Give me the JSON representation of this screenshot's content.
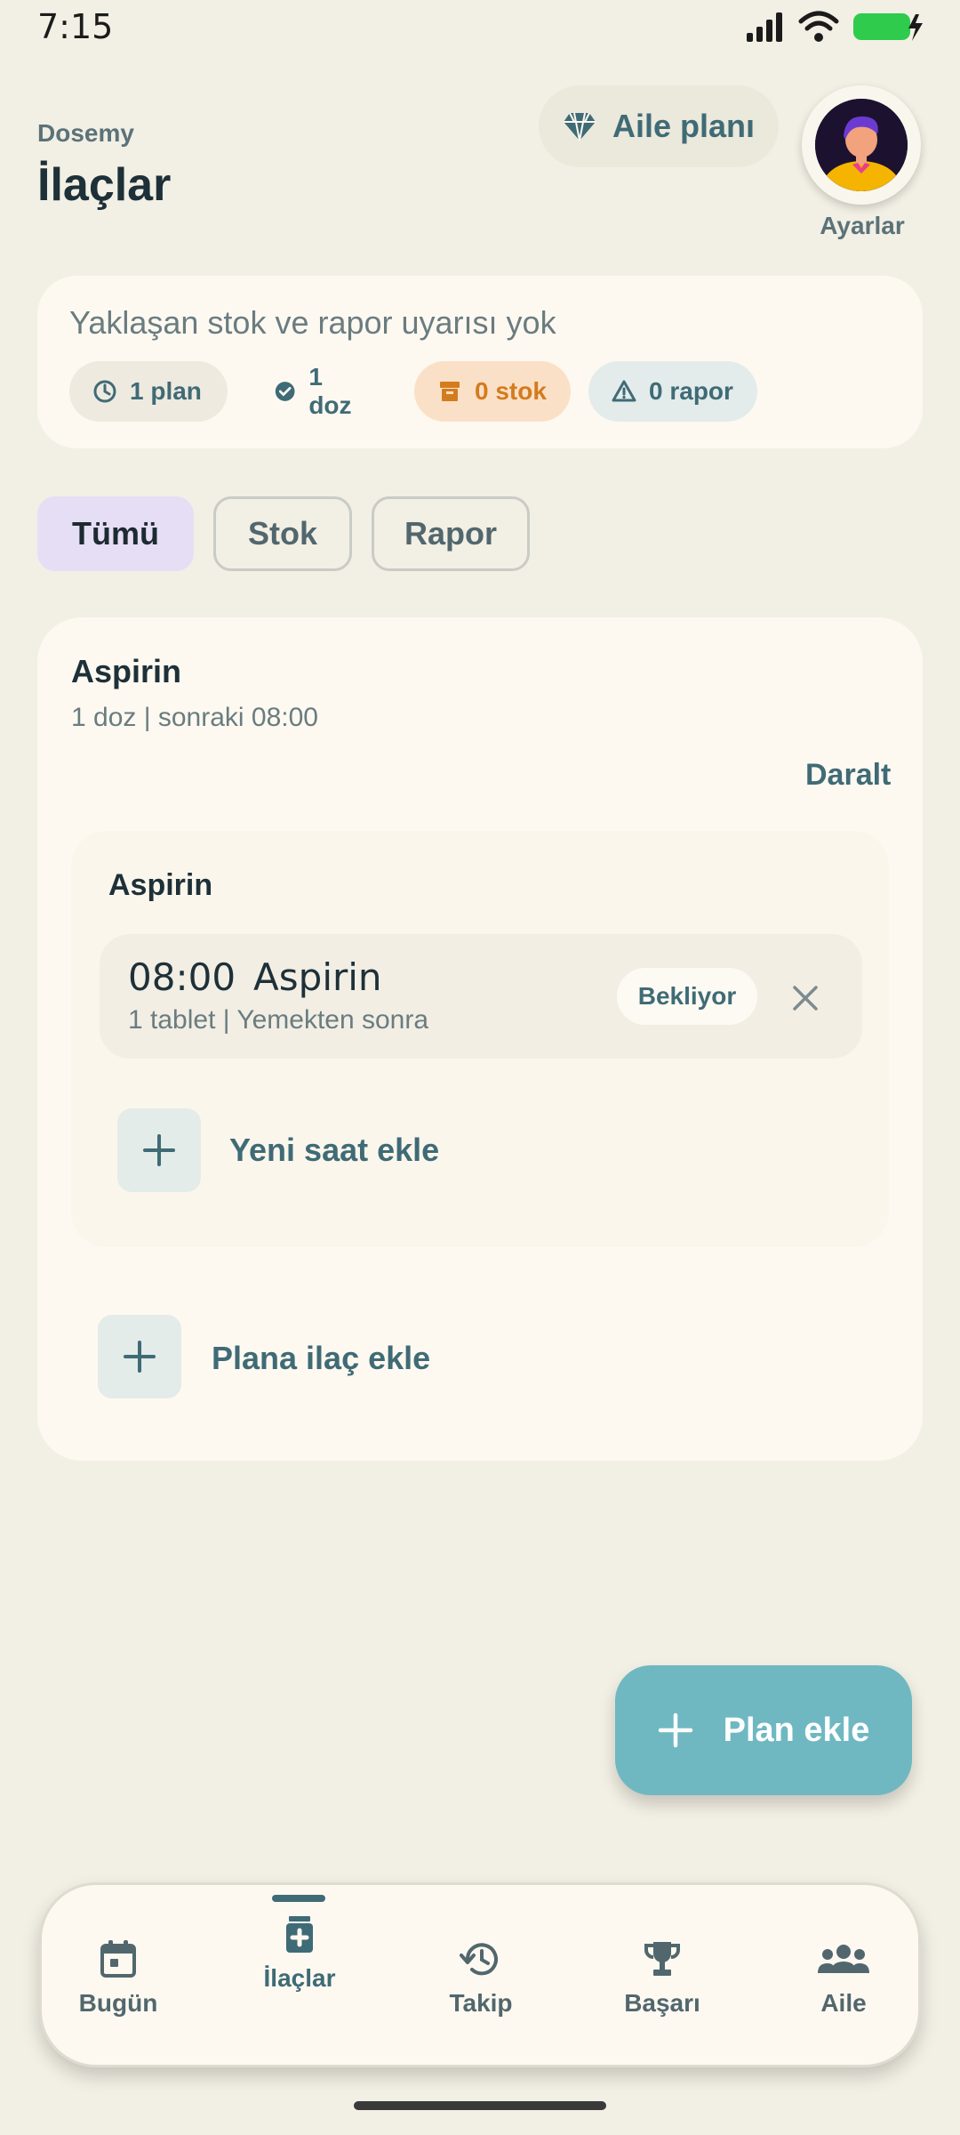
{
  "status_bar": {
    "time": "7:15"
  },
  "header": {
    "app_name": "Dosemy",
    "title": "İlaçlar",
    "family_plan_label": "Aile planı",
    "settings_label": "Ayarlar"
  },
  "summary": {
    "text": "Yaklaşan stok ve rapor uyarısı yok",
    "chips": {
      "plan": "1 plan",
      "doz": "1 doz",
      "stok": "0 stok",
      "rapor": "0 rapor"
    }
  },
  "filters": {
    "all": "Tümü",
    "stok": "Stok",
    "rapor": "Rapor",
    "selected": "Tümü"
  },
  "plan": {
    "name": "Aspirin",
    "subtitle": "1 doz | sonraki 08:00",
    "collapse_label": "Daralt",
    "group_title": "Aspirin",
    "dose": {
      "time": "08:00",
      "name": "Aspirin",
      "detail": "1 tablet | Yemekten sonra",
      "status": "Bekliyor"
    },
    "add_time_label": "Yeni saat ekle",
    "add_med_label": "Plana ilaç ekle"
  },
  "fab_label": "Plan ekle",
  "bottom_nav": {
    "today": "Bugün",
    "meds": "İlaçlar",
    "tracking": "Takip",
    "achievements": "Başarı",
    "family": "Aile",
    "active": "İlaçlar"
  },
  "colors": {
    "background": "#f2efe4",
    "card": "#fdf9f1",
    "accent": "#3f6b76",
    "fab": "#6fb8c2",
    "warning": "#d37c1e"
  }
}
